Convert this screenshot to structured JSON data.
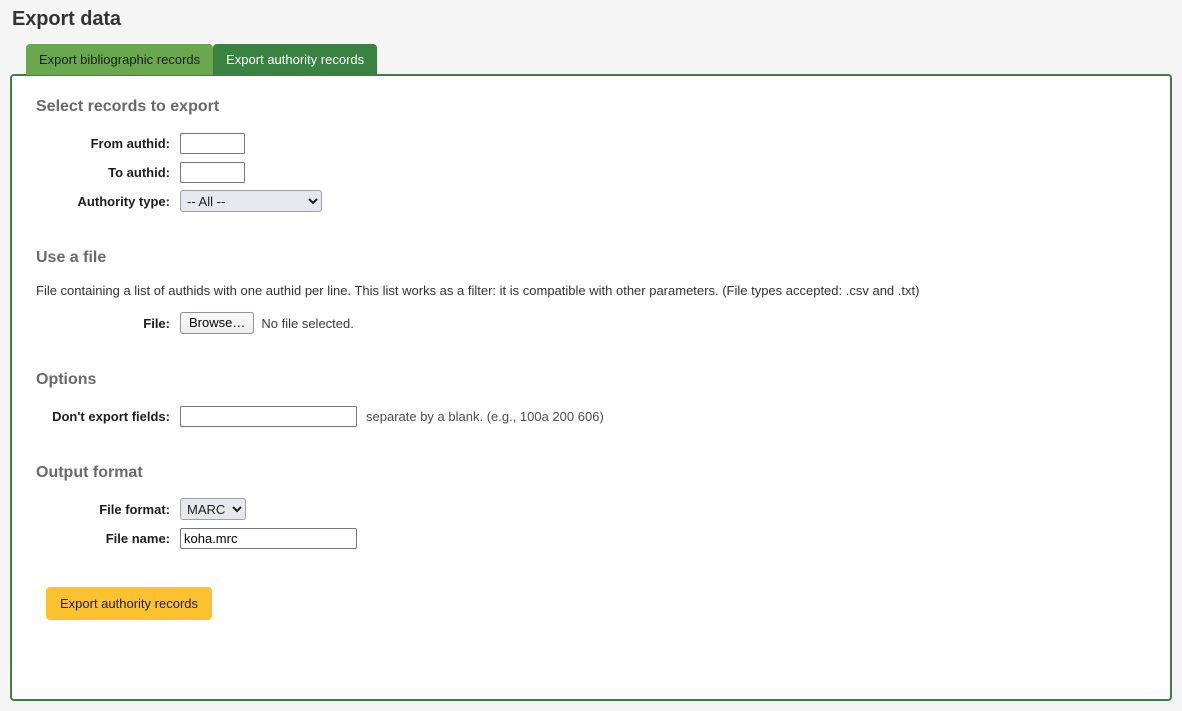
{
  "page": {
    "title": "Export data",
    "accent_green_active": "#3a8242",
    "accent_green_inactive": "#6aa84f",
    "accent_button": "#fcc22d",
    "background": "#f4f5f4"
  },
  "tabs": [
    {
      "label": "Export bibliographic records",
      "active": false
    },
    {
      "label": "Export authority records",
      "active": true
    }
  ],
  "sections": {
    "select_records": {
      "heading": "Select records to export",
      "from_authid_label": "From authid:",
      "from_authid_value": "",
      "to_authid_label": "To authid:",
      "to_authid_value": "",
      "authority_type_label": "Authority type:",
      "authority_type_value": "-- All --",
      "authority_type_options": [
        "-- All --"
      ]
    },
    "use_a_file": {
      "heading": "Use a file",
      "help": "File containing a list of authids with one authid per line. This list works as a filter: it is compatible with other parameters. (File types accepted: .csv and .txt)",
      "file_label": "File:",
      "browse_label": "Browse…",
      "no_file_text": "No file selected."
    },
    "options": {
      "heading": "Options",
      "dont_export_label": "Don't export fields:",
      "dont_export_value": "",
      "dont_export_hint": "separate by a blank. (e.g., 100a 200 606)"
    },
    "output_format": {
      "heading": "Output format",
      "file_format_label": "File format:",
      "file_format_value": "MARC",
      "file_format_options": [
        "MARC"
      ],
      "file_name_label": "File name:",
      "file_name_value": "koha.mrc"
    }
  },
  "submit": {
    "label": "Export authority records"
  }
}
